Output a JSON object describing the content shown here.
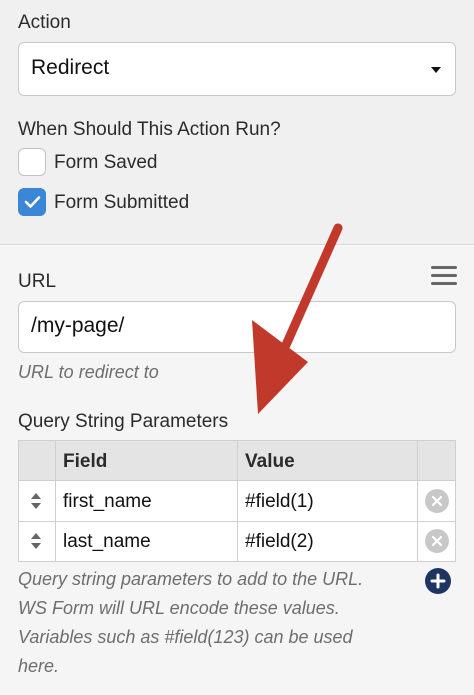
{
  "action": {
    "label": "Action",
    "selected": "Redirect"
  },
  "run_when": {
    "label": "When Should This Action Run?",
    "options": [
      {
        "label": "Form Saved",
        "checked": false
      },
      {
        "label": "Form Submitted",
        "checked": true
      }
    ]
  },
  "url": {
    "label": "URL",
    "value": "/my-page/",
    "help": "URL to redirect to"
  },
  "query": {
    "label": "Query String Parameters",
    "headers": {
      "field": "Field",
      "value": "Value"
    },
    "rows": [
      {
        "field": "first_name",
        "value": "#field(1)"
      },
      {
        "field": "last_name",
        "value": "#field(2)"
      }
    ],
    "note_lines": [
      "Query string parameters to add to the URL.",
      "WS Form will URL encode these values.",
      "Variables such as #field(123) can be used",
      "here."
    ]
  },
  "colors": {
    "checkbox_checked": "#3b86d6",
    "add_button": "#1e3564",
    "annotation_arrow": "#c1392b"
  },
  "icons": {
    "select_caret": "caret-down-icon",
    "url_menu": "hamburger-menu-icon",
    "row_sort": "sort-arrows-icon",
    "row_delete": "remove-circle-icon",
    "add_row": "add-circle-icon",
    "annotation": "red-arrow-annotation"
  }
}
